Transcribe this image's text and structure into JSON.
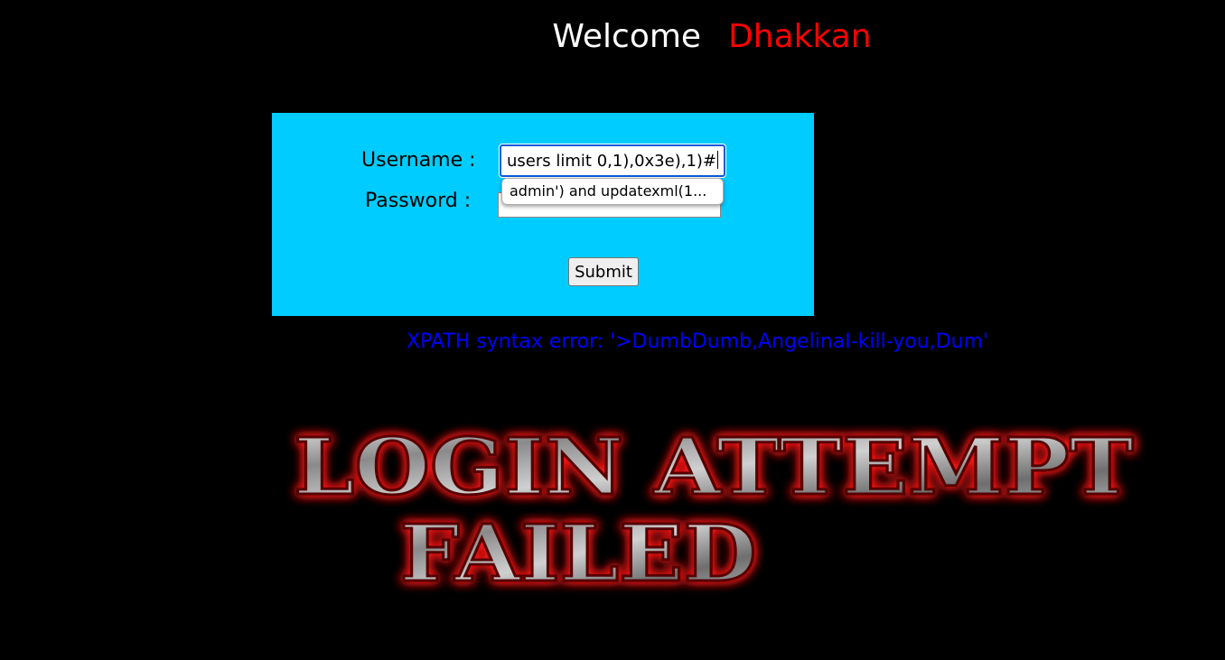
{
  "header": {
    "welcome": "Welcome",
    "name": "Dhakkan"
  },
  "form": {
    "username_label": "Username :",
    "password_label": "Password :",
    "username_value": "users limit 0,1),0x3e),1)#",
    "password_value": "",
    "autocomplete_suggestion": "admin') and updatexml(1...",
    "submit_label": "Submit"
  },
  "result": {
    "error_message": "XPATH syntax error: '>DumbDumb,AngelinaI-kill-you,Dum'",
    "banner_line1": "LOGIN ATTEMPT",
    "banner_line2": "FAILED"
  },
  "colors": {
    "background": "#000000",
    "panel": "#00ccff",
    "name": "#ff0000",
    "error": "#0000ff",
    "banner_glow": "#ff0000"
  }
}
